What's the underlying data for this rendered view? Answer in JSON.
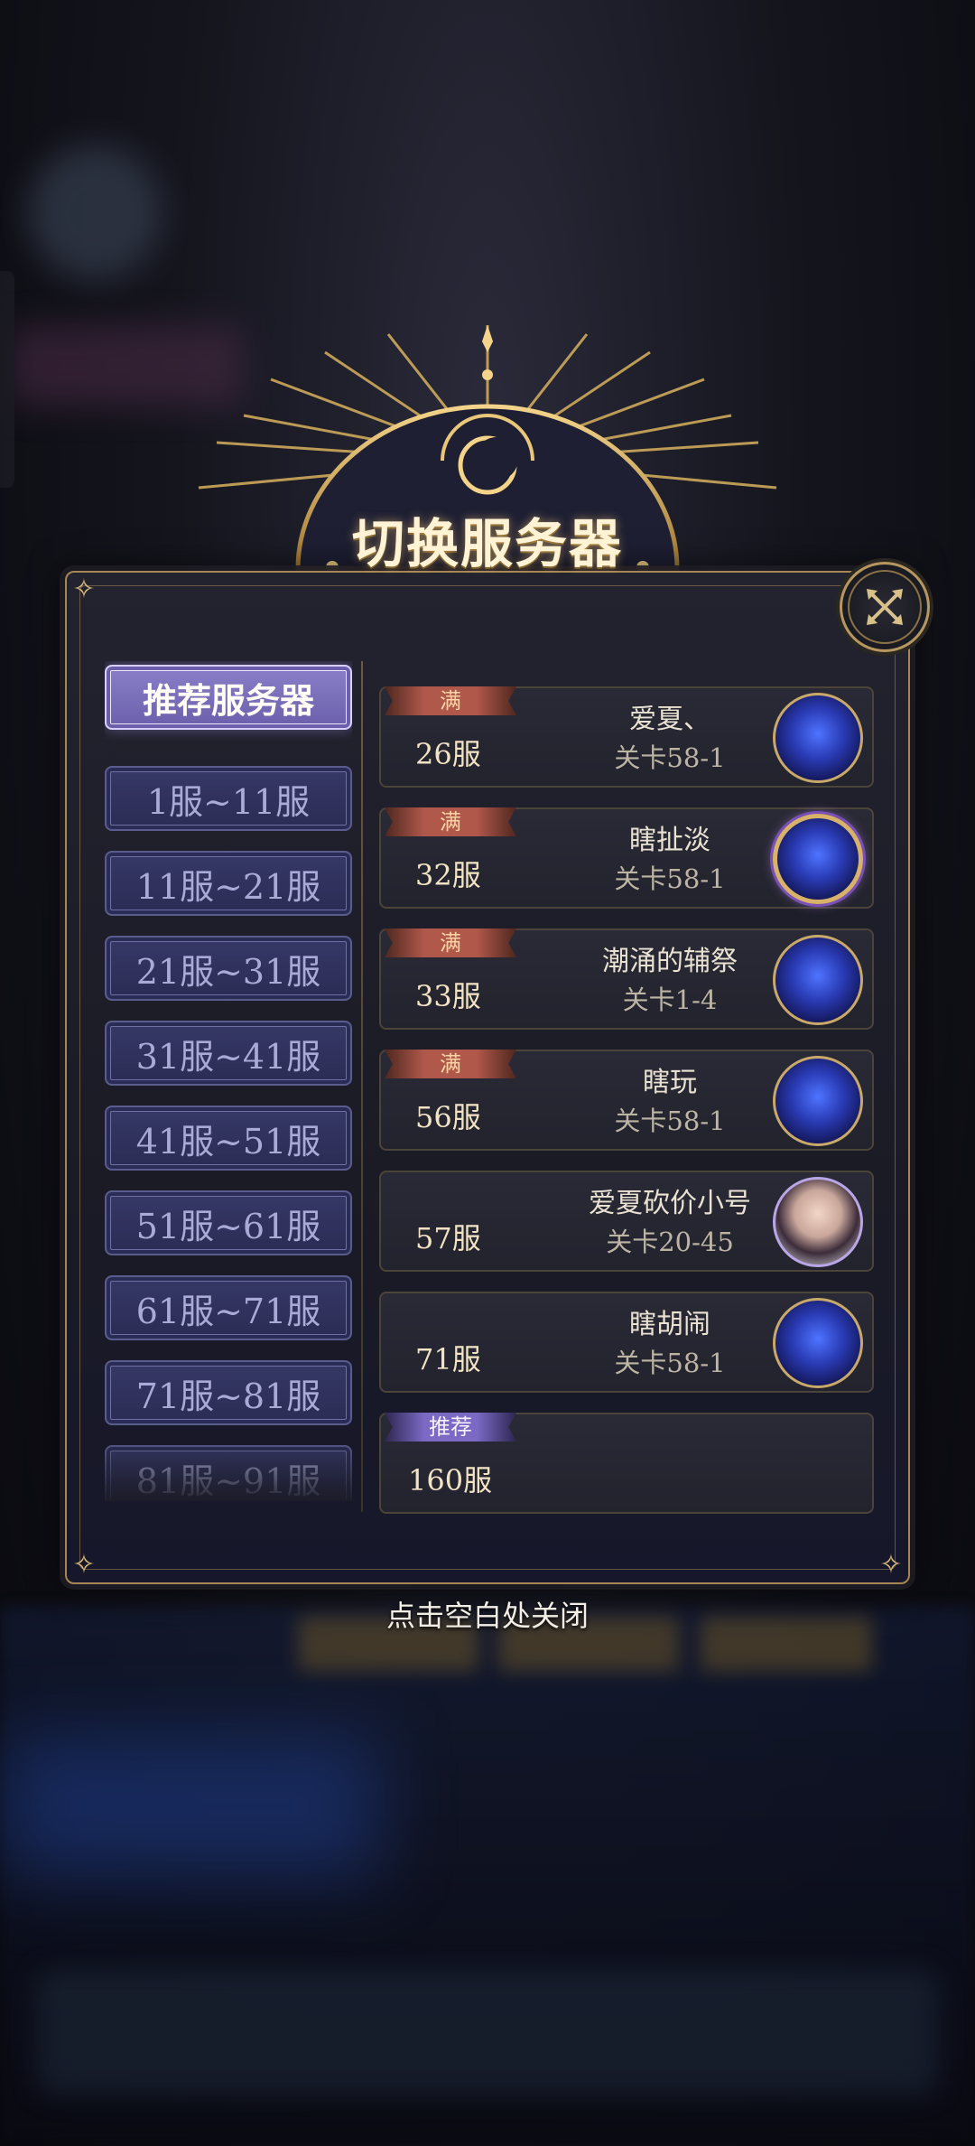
{
  "dialog": {
    "title": "切换服务器",
    "close_icon": "close-x-icon",
    "dismiss_hint": "点击空白处关闭"
  },
  "range_list": [
    {
      "label": "推荐服务器",
      "active": true
    },
    {
      "label": "1服~11服",
      "active": false
    },
    {
      "label": "11服~21服",
      "active": false
    },
    {
      "label": "21服~31服",
      "active": false
    },
    {
      "label": "31服~41服",
      "active": false
    },
    {
      "label": "41服~51服",
      "active": false
    },
    {
      "label": "51服~61服",
      "active": false
    },
    {
      "label": "61服~71服",
      "active": false
    },
    {
      "label": "71服~81服",
      "active": false
    },
    {
      "label": "81服~91服",
      "active": false
    }
  ],
  "servers": [
    {
      "tag": "满",
      "name": "26服",
      "player": "爱夏、",
      "stage": "关卡58-1",
      "avatar": "hooded-figure-avatar"
    },
    {
      "tag": "满",
      "name": "32服",
      "player": "瞎扯淡",
      "stage": "关卡58-1",
      "avatar": "hooded-figure-avatar"
    },
    {
      "tag": "满",
      "name": "33服",
      "player": "潮涌的辅祭",
      "stage": "关卡1-4",
      "avatar": "hooded-figure-avatar"
    },
    {
      "tag": "满",
      "name": "56服",
      "player": "瞎玩",
      "stage": "关卡58-1",
      "avatar": "hooded-figure-avatar"
    },
    {
      "tag": "",
      "name": "57服",
      "player": "爱夏砍价小号",
      "stage": "关卡20-45",
      "avatar": "angel-character-avatar"
    },
    {
      "tag": "",
      "name": "71服",
      "player": "瞎胡闹",
      "stage": "关卡58-1",
      "avatar": "hooded-figure-avatar"
    },
    {
      "tag": "推荐",
      "name": "160服",
      "player": "",
      "stage": "",
      "avatar": ""
    }
  ],
  "colors": {
    "gold_border": "#a68654",
    "full_tag": "#b0584a",
    "recommend_tag": "#7b69c4",
    "active_range": "#8a7fc8",
    "range_button": "#2b2c55"
  }
}
